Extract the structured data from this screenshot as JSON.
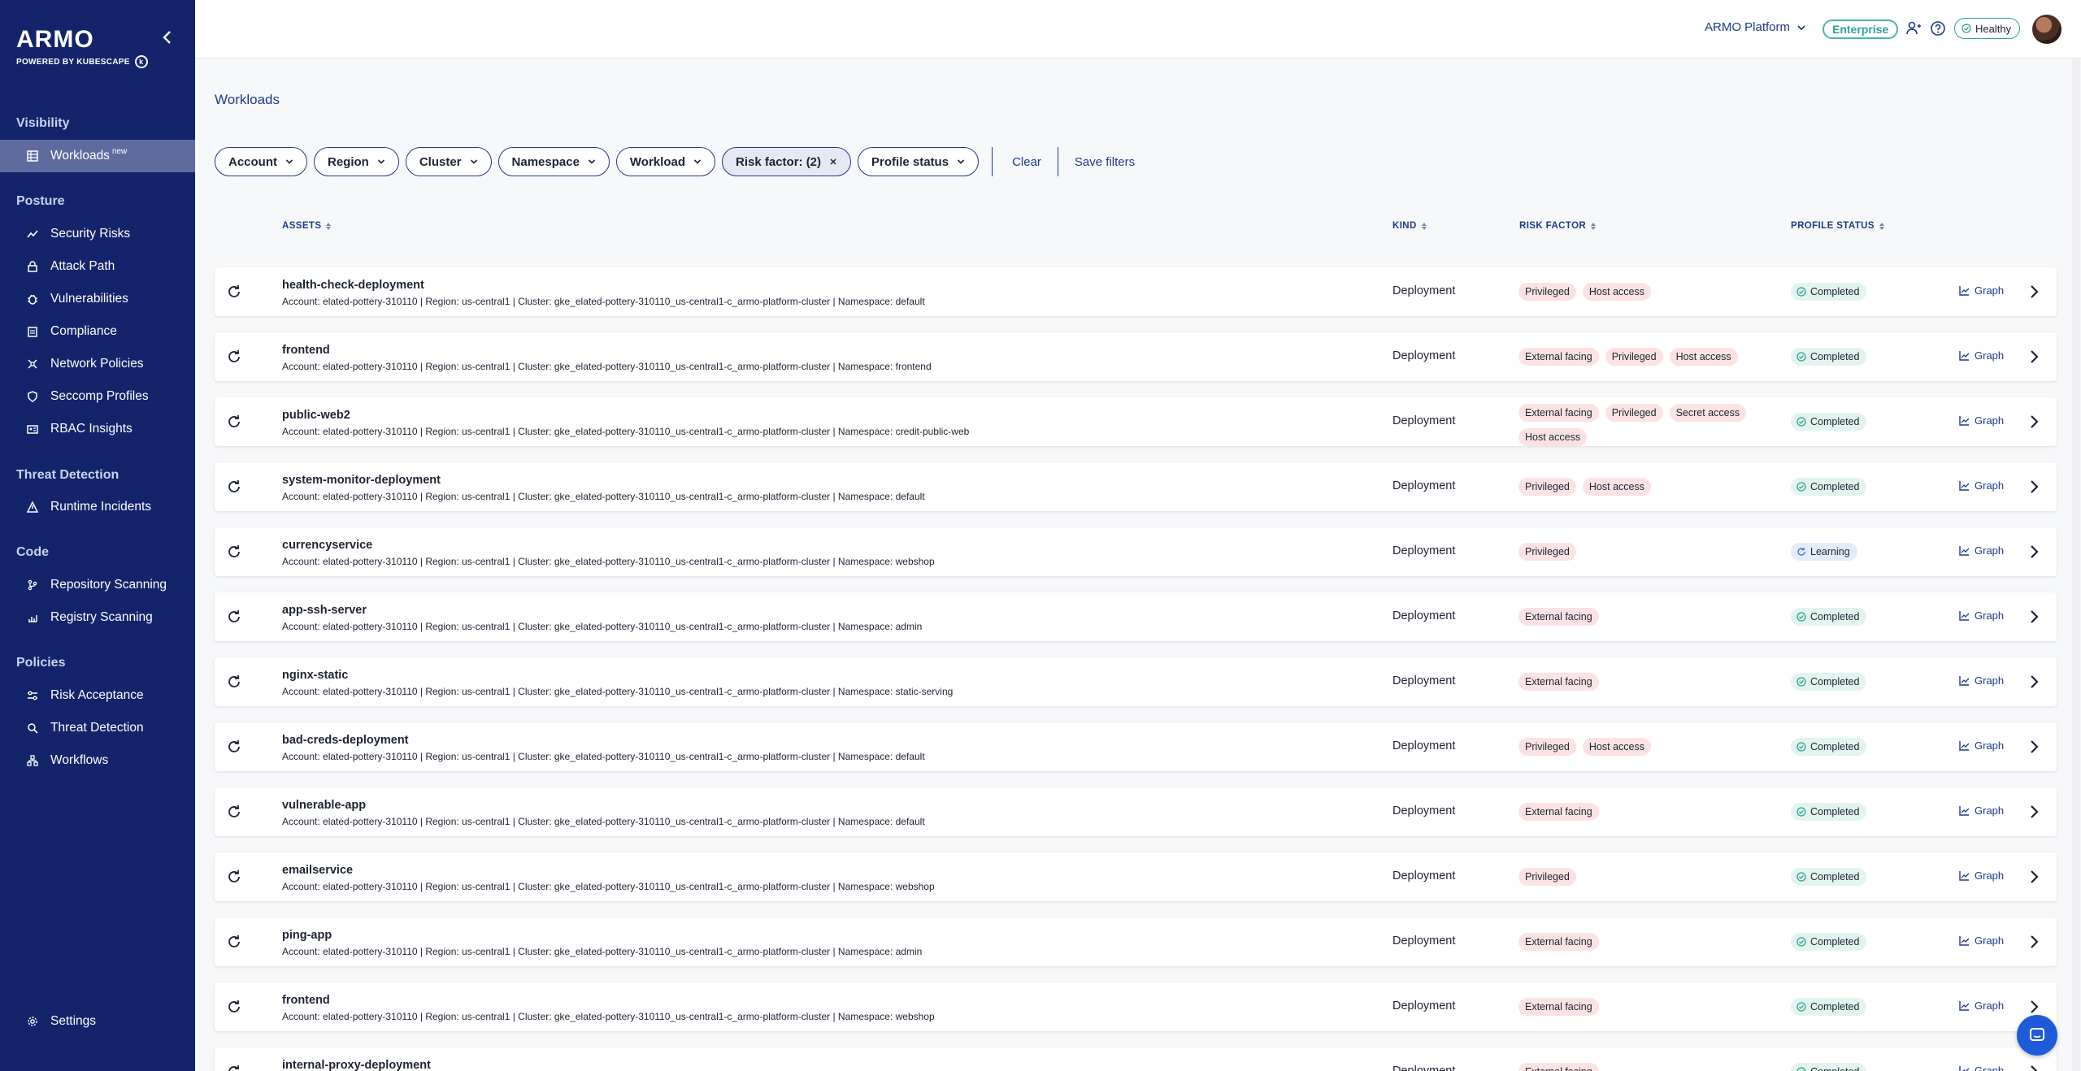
{
  "brand": {
    "name": "ARMO",
    "subtitle": "POWERED BY KUBESCAPE"
  },
  "sidebar": {
    "sections": [
      {
        "label": "Visibility",
        "items": [
          {
            "label": "Workloads",
            "badge": "new",
            "icon": "grid-icon",
            "active": true
          }
        ]
      },
      {
        "label": "Posture",
        "items": [
          {
            "label": "Security Risks",
            "icon": "trend-icon"
          },
          {
            "label": "Attack Path",
            "icon": "lock-icon"
          },
          {
            "label": "Vulnerabilities",
            "icon": "bug-icon"
          },
          {
            "label": "Compliance",
            "icon": "clipboard-icon"
          },
          {
            "label": "Network Policies",
            "icon": "network-icon"
          },
          {
            "label": "Seccomp Profiles",
            "icon": "shield-icon"
          },
          {
            "label": "RBAC Insights",
            "icon": "id-card-icon"
          }
        ]
      },
      {
        "label": "Threat Detection",
        "items": [
          {
            "label": "Runtime Incidents",
            "icon": "warning-icon"
          }
        ]
      },
      {
        "label": "Code",
        "items": [
          {
            "label": "Repository Scanning",
            "icon": "git-branch-icon"
          },
          {
            "label": "Registry Scanning",
            "icon": "registry-icon"
          }
        ]
      },
      {
        "label": "Policies",
        "items": [
          {
            "label": "Risk Acceptance",
            "icon": "sliders-icon"
          },
          {
            "label": "Threat Detection",
            "icon": "magnifier-icon"
          },
          {
            "label": "Workflows",
            "icon": "workflow-icon"
          }
        ]
      }
    ],
    "settings_label": "Settings"
  },
  "topbar": {
    "platform": "ARMO Platform",
    "plan": "Enterprise",
    "health": "Healthy"
  },
  "page": {
    "title": "Workloads"
  },
  "filters": {
    "chips": [
      "Account",
      "Region",
      "Cluster",
      "Namespace",
      "Workload"
    ],
    "risk_factor": "Risk factor: (2)",
    "profile_status": "Profile status",
    "clear": "Clear",
    "save": "Save filters"
  },
  "table": {
    "headers": {
      "assets": "ASSETS",
      "kind": "KIND",
      "risk_factor": "RISK FACTOR",
      "profile_status": "PROFILE STATUS"
    },
    "graph_label": "Graph",
    "rows": [
      {
        "name": "health-check-deployment",
        "meta": "Account: elated-pottery-310110 | Region: us-central1 | Cluster: gke_elated-pottery-310110_us-central1-c_armo-platform-cluster | Namespace: default",
        "kind": "Deployment",
        "risks": [
          "Privileged",
          "Host access"
        ],
        "status": "Completed"
      },
      {
        "name": "frontend",
        "meta": "Account: elated-pottery-310110 | Region: us-central1 | Cluster: gke_elated-pottery-310110_us-central1-c_armo-platform-cluster | Namespace: frontend",
        "kind": "Deployment",
        "risks": [
          "External facing",
          "Privileged",
          "Host access"
        ],
        "status": "Completed"
      },
      {
        "name": "public-web2",
        "meta": "Account: elated-pottery-310110 | Region: us-central1 | Cluster: gke_elated-pottery-310110_us-central1-c_armo-platform-cluster | Namespace: credit-public-web",
        "kind": "Deployment",
        "risks": [
          "External facing",
          "Privileged",
          "Secret access",
          "Host access"
        ],
        "status": "Completed"
      },
      {
        "name": "system-monitor-deployment",
        "meta": "Account: elated-pottery-310110 | Region: us-central1 | Cluster: gke_elated-pottery-310110_us-central1-c_armo-platform-cluster | Namespace: default",
        "kind": "Deployment",
        "risks": [
          "Privileged",
          "Host access"
        ],
        "status": "Completed"
      },
      {
        "name": "currencyservice",
        "meta": "Account: elated-pottery-310110 | Region: us-central1 | Cluster: gke_elated-pottery-310110_us-central1-c_armo-platform-cluster | Namespace: webshop",
        "kind": "Deployment",
        "risks": [
          "Privileged"
        ],
        "status": "Learning"
      },
      {
        "name": "app-ssh-server",
        "meta": "Account: elated-pottery-310110 | Region: us-central1 | Cluster: gke_elated-pottery-310110_us-central1-c_armo-platform-cluster | Namespace: admin",
        "kind": "Deployment",
        "risks": [
          "External facing"
        ],
        "status": "Completed"
      },
      {
        "name": "nginx-static",
        "meta": "Account: elated-pottery-310110 | Region: us-central1 | Cluster: gke_elated-pottery-310110_us-central1-c_armo-platform-cluster | Namespace: static-serving",
        "kind": "Deployment",
        "risks": [
          "External facing"
        ],
        "status": "Completed"
      },
      {
        "name": "bad-creds-deployment",
        "meta": "Account: elated-pottery-310110 | Region: us-central1 | Cluster: gke_elated-pottery-310110_us-central1-c_armo-platform-cluster | Namespace: default",
        "kind": "Deployment",
        "risks": [
          "Privileged",
          "Host access"
        ],
        "status": "Completed"
      },
      {
        "name": "vulnerable-app",
        "meta": "Account: elated-pottery-310110 | Region: us-central1 | Cluster: gke_elated-pottery-310110_us-central1-c_armo-platform-cluster | Namespace: default",
        "kind": "Deployment",
        "risks": [
          "External facing"
        ],
        "status": "Completed"
      },
      {
        "name": "emailservice",
        "meta": "Account: elated-pottery-310110 | Region: us-central1 | Cluster: gke_elated-pottery-310110_us-central1-c_armo-platform-cluster | Namespace: webshop",
        "kind": "Deployment",
        "risks": [
          "Privileged"
        ],
        "status": "Completed"
      },
      {
        "name": "ping-app",
        "meta": "Account: elated-pottery-310110 | Region: us-central1 | Cluster: gke_elated-pottery-310110_us-central1-c_armo-platform-cluster | Namespace: admin",
        "kind": "Deployment",
        "risks": [
          "External facing"
        ],
        "status": "Completed"
      },
      {
        "name": "frontend",
        "meta": "Account: elated-pottery-310110 | Region: us-central1 | Cluster: gke_elated-pottery-310110_us-central1-c_armo-platform-cluster | Namespace: webshop",
        "kind": "Deployment",
        "risks": [
          "External facing"
        ],
        "status": "Completed"
      },
      {
        "name": "internal-proxy-deployment",
        "meta": "",
        "kind": "Deployment",
        "risks": [
          "External facing"
        ],
        "status": "Completed"
      }
    ]
  },
  "colors": {
    "sidebar": "#13246b",
    "accent": "#1f3a8a",
    "risk_tag": "#fbe3e3",
    "completed": "#e3f4ee",
    "learning": "#e2ecfb",
    "enterprise": "#2ea395"
  }
}
